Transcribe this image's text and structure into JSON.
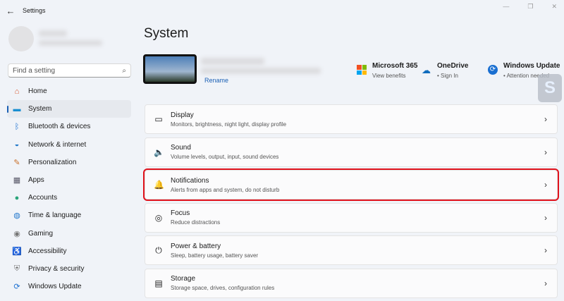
{
  "app": {
    "title": "Settings",
    "back_icon": "back-arrow-icon"
  },
  "search": {
    "placeholder": "Find a setting"
  },
  "nav": [
    {
      "label": "Home",
      "icon": "home-icon",
      "glyph": "⌂",
      "color": "#d9552b"
    },
    {
      "label": "System",
      "icon": "system-icon",
      "glyph": "▬",
      "color": "#1a8fd1",
      "active": true
    },
    {
      "label": "Bluetooth & devices",
      "icon": "bluetooth-icon",
      "glyph": "ᛒ",
      "color": "#1a6fd1"
    },
    {
      "label": "Network & internet",
      "icon": "wifi-icon",
      "glyph": "◒",
      "color": "#2077c9"
    },
    {
      "label": "Personalization",
      "icon": "brush-icon",
      "glyph": "✎",
      "color": "#c9702a"
    },
    {
      "label": "Apps",
      "icon": "apps-icon",
      "glyph": "▦",
      "color": "#556"
    },
    {
      "label": "Accounts",
      "icon": "accounts-icon",
      "glyph": "●",
      "color": "#2aa47a"
    },
    {
      "label": "Time & language",
      "icon": "globe-icon",
      "glyph": "◍",
      "color": "#2277cc"
    },
    {
      "label": "Gaming",
      "icon": "gamepad-icon",
      "glyph": "◉",
      "color": "#777"
    },
    {
      "label": "Accessibility",
      "icon": "accessibility-icon",
      "glyph": "♿",
      "color": "#1a6fd1"
    },
    {
      "label": "Privacy & security",
      "icon": "shield-icon",
      "glyph": "⛨",
      "color": "#777"
    },
    {
      "label": "Windows Update",
      "icon": "update-icon",
      "glyph": "⟳",
      "color": "#1a6fd1"
    }
  ],
  "main": {
    "title": "System",
    "rename": "Rename",
    "services": [
      {
        "title": "Microsoft 365",
        "sub": "View benefits",
        "icon": "microsoft-365-icon"
      },
      {
        "title": "OneDrive",
        "sub": "• Sign In",
        "icon": "onedrive-icon"
      },
      {
        "title": "Windows Update",
        "sub": "• Attention needed",
        "icon": "windows-update-icon"
      }
    ],
    "cards": [
      {
        "title": "Display",
        "sub": "Monitors, brightness, night light, display profile",
        "glyph": "▭"
      },
      {
        "title": "Sound",
        "sub": "Volume levels, output, input, sound devices",
        "glyph": "🔈"
      },
      {
        "title": "Notifications",
        "sub": "Alerts from apps and system, do not disturb",
        "glyph": "🔔"
      },
      {
        "title": "Focus",
        "sub": "Reduce distractions",
        "glyph": "◎"
      },
      {
        "title": "Power & battery",
        "sub": "Sleep, battery usage, battery saver",
        "glyph": "⏻"
      },
      {
        "title": "Storage",
        "sub": "Storage space, drives, configuration rules",
        "glyph": "▤"
      }
    ]
  }
}
